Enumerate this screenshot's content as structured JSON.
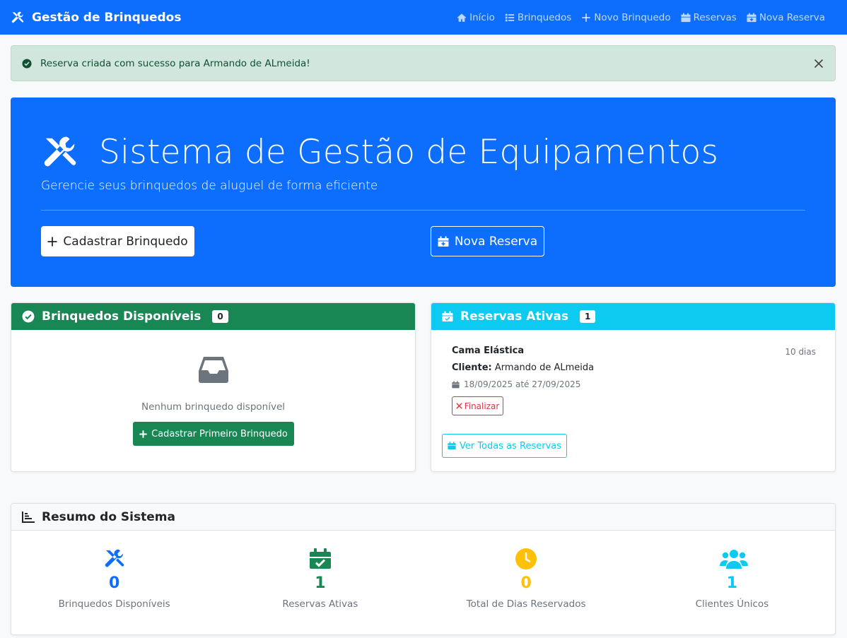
{
  "navbar": {
    "brand": "Gestão de Brinquedos",
    "brand_icon": "tools-icon",
    "links": [
      {
        "label": "Início",
        "icon": "home-icon"
      },
      {
        "label": "Brinquedos",
        "icon": "list-icon"
      },
      {
        "label": "Novo Brinquedo",
        "icon": "plus-icon"
      },
      {
        "label": "Reservas",
        "icon": "calendar-icon"
      },
      {
        "label": "Nova Reserva",
        "icon": "calendar-plus-icon"
      }
    ]
  },
  "alert": {
    "message": "Reserva criada com sucesso para Armando de ALmeida!",
    "icon": "check-circle-icon"
  },
  "hero": {
    "title": "Sistema de Gestão de Equipamentos",
    "subtitle": "Gerencie seus brinquedos de aluguel de forma eficiente",
    "primary_button": "Cadastrar Brinquedo",
    "secondary_button": "Nova Reserva"
  },
  "available": {
    "title": "Brinquedos Disponíveis",
    "count": "0",
    "empty_text": "Nenhum brinquedo disponível",
    "button": "Cadastrar Primeiro Brinquedo"
  },
  "reservations": {
    "title": "Reservas Ativas",
    "count": "1",
    "items": [
      {
        "name": "Cama Elástica",
        "days": "10 dias",
        "client_label": "Cliente:",
        "client": "Armando de ALmeida",
        "dates": "18/09/2025 até 27/09/2025",
        "action": "Finalizar"
      }
    ],
    "view_all": "Ver Todas as Reservas"
  },
  "summary": {
    "title": "Resumo do Sistema",
    "stats": [
      {
        "value": "0",
        "label": "Brinquedos Disponíveis",
        "color": "#0d6efd",
        "icon": "tools-icon"
      },
      {
        "value": "1",
        "label": "Reservas Ativas",
        "color": "#198754",
        "icon": "calendar-check-icon"
      },
      {
        "value": "0",
        "label": "Total de Dias Reservados",
        "color": "#ffc107",
        "icon": "clock-icon"
      },
      {
        "value": "1",
        "label": "Clientes Únicos",
        "color": "#0dcaf0",
        "icon": "users-icon"
      }
    ]
  },
  "colors": {
    "primary": "#0d6efd",
    "success": "#198754",
    "info": "#0dcaf0",
    "warning": "#ffc107",
    "danger": "#dc3545"
  }
}
